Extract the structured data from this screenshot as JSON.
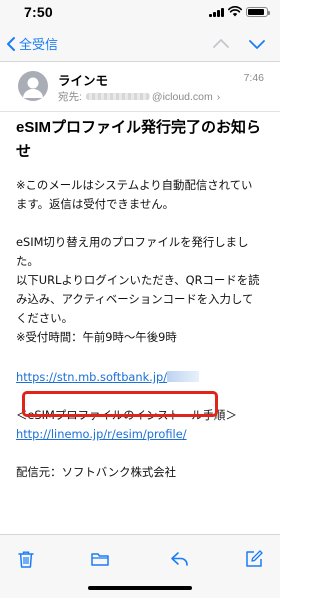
{
  "status": {
    "time": "7:50",
    "battery_level": 0.9
  },
  "nav": {
    "back_label": "全受信"
  },
  "header": {
    "sender": "ラインモ",
    "recipient_prefix": "宛先:",
    "recipient_domain": "@icloud.com",
    "chevron": "›",
    "time": "7:46"
  },
  "mail": {
    "subject_line1": "eSIMプロファイル発行完了のお知ら",
    "subject_line2": "せ",
    "notice_line1": "※このメールはシステムより自動配信されてい",
    "notice_line2": "ます。返信は受付できません。",
    "body_line1": "eSIM切り替え用のプロファイルを発行しまし",
    "body_line2": "た。",
    "body_line3": "以下URLよりログインいただき、QRコードを読",
    "body_line4": "み込み、アクティベーションコードを入力して",
    "body_line5": "ください。",
    "hours": "※受付時間：午前9時〜午後9時",
    "url": "https://stn.mb.softbank.jp/",
    "install_heading": "＜eSIMプロファイルのインストール手順＞",
    "install_url": "http://linemo.jp/r/esim/profile/",
    "distributor": "配信元：ソフトバンク株式会社"
  },
  "colors": {
    "accent": "#1a7df5",
    "highlight": "#e0241a"
  },
  "icons": [
    "trash-icon",
    "folder-icon",
    "reply-icon",
    "compose-icon"
  ]
}
